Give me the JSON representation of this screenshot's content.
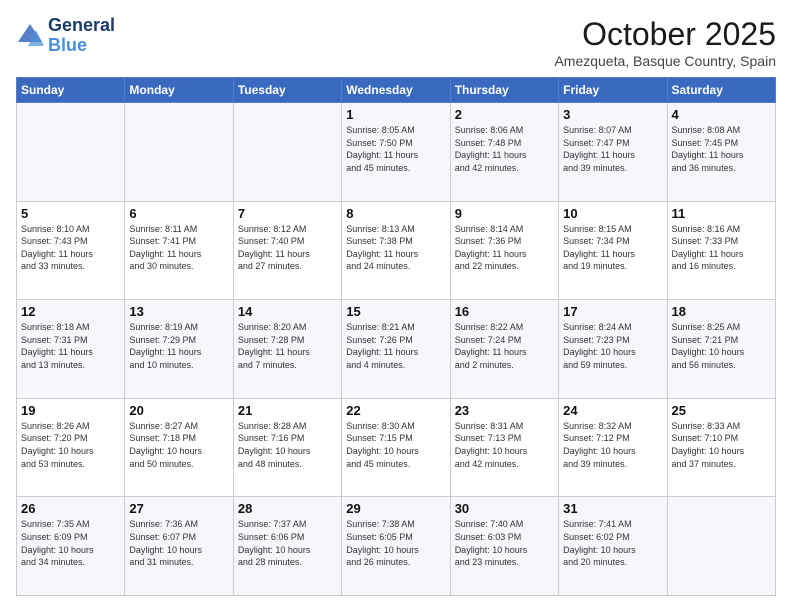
{
  "logo": {
    "line1": "General",
    "line2": "Blue"
  },
  "header": {
    "title": "October 2025",
    "subtitle": "Amezqueta, Basque Country, Spain"
  },
  "weekdays": [
    "Sunday",
    "Monday",
    "Tuesday",
    "Wednesday",
    "Thursday",
    "Friday",
    "Saturday"
  ],
  "weeks": [
    [
      {
        "day": "",
        "info": ""
      },
      {
        "day": "",
        "info": ""
      },
      {
        "day": "",
        "info": ""
      },
      {
        "day": "1",
        "info": "Sunrise: 8:05 AM\nSunset: 7:50 PM\nDaylight: 11 hours\nand 45 minutes."
      },
      {
        "day": "2",
        "info": "Sunrise: 8:06 AM\nSunset: 7:48 PM\nDaylight: 11 hours\nand 42 minutes."
      },
      {
        "day": "3",
        "info": "Sunrise: 8:07 AM\nSunset: 7:47 PM\nDaylight: 11 hours\nand 39 minutes."
      },
      {
        "day": "4",
        "info": "Sunrise: 8:08 AM\nSunset: 7:45 PM\nDaylight: 11 hours\nand 36 minutes."
      }
    ],
    [
      {
        "day": "5",
        "info": "Sunrise: 8:10 AM\nSunset: 7:43 PM\nDaylight: 11 hours\nand 33 minutes."
      },
      {
        "day": "6",
        "info": "Sunrise: 8:11 AM\nSunset: 7:41 PM\nDaylight: 11 hours\nand 30 minutes."
      },
      {
        "day": "7",
        "info": "Sunrise: 8:12 AM\nSunset: 7:40 PM\nDaylight: 11 hours\nand 27 minutes."
      },
      {
        "day": "8",
        "info": "Sunrise: 8:13 AM\nSunset: 7:38 PM\nDaylight: 11 hours\nand 24 minutes."
      },
      {
        "day": "9",
        "info": "Sunrise: 8:14 AM\nSunset: 7:36 PM\nDaylight: 11 hours\nand 22 minutes."
      },
      {
        "day": "10",
        "info": "Sunrise: 8:15 AM\nSunset: 7:34 PM\nDaylight: 11 hours\nand 19 minutes."
      },
      {
        "day": "11",
        "info": "Sunrise: 8:16 AM\nSunset: 7:33 PM\nDaylight: 11 hours\nand 16 minutes."
      }
    ],
    [
      {
        "day": "12",
        "info": "Sunrise: 8:18 AM\nSunset: 7:31 PM\nDaylight: 11 hours\nand 13 minutes."
      },
      {
        "day": "13",
        "info": "Sunrise: 8:19 AM\nSunset: 7:29 PM\nDaylight: 11 hours\nand 10 minutes."
      },
      {
        "day": "14",
        "info": "Sunrise: 8:20 AM\nSunset: 7:28 PM\nDaylight: 11 hours\nand 7 minutes."
      },
      {
        "day": "15",
        "info": "Sunrise: 8:21 AM\nSunset: 7:26 PM\nDaylight: 11 hours\nand 4 minutes."
      },
      {
        "day": "16",
        "info": "Sunrise: 8:22 AM\nSunset: 7:24 PM\nDaylight: 11 hours\nand 2 minutes."
      },
      {
        "day": "17",
        "info": "Sunrise: 8:24 AM\nSunset: 7:23 PM\nDaylight: 10 hours\nand 59 minutes."
      },
      {
        "day": "18",
        "info": "Sunrise: 8:25 AM\nSunset: 7:21 PM\nDaylight: 10 hours\nand 56 minutes."
      }
    ],
    [
      {
        "day": "19",
        "info": "Sunrise: 8:26 AM\nSunset: 7:20 PM\nDaylight: 10 hours\nand 53 minutes."
      },
      {
        "day": "20",
        "info": "Sunrise: 8:27 AM\nSunset: 7:18 PM\nDaylight: 10 hours\nand 50 minutes."
      },
      {
        "day": "21",
        "info": "Sunrise: 8:28 AM\nSunset: 7:16 PM\nDaylight: 10 hours\nand 48 minutes."
      },
      {
        "day": "22",
        "info": "Sunrise: 8:30 AM\nSunset: 7:15 PM\nDaylight: 10 hours\nand 45 minutes."
      },
      {
        "day": "23",
        "info": "Sunrise: 8:31 AM\nSunset: 7:13 PM\nDaylight: 10 hours\nand 42 minutes."
      },
      {
        "day": "24",
        "info": "Sunrise: 8:32 AM\nSunset: 7:12 PM\nDaylight: 10 hours\nand 39 minutes."
      },
      {
        "day": "25",
        "info": "Sunrise: 8:33 AM\nSunset: 7:10 PM\nDaylight: 10 hours\nand 37 minutes."
      }
    ],
    [
      {
        "day": "26",
        "info": "Sunrise: 7:35 AM\nSunset: 6:09 PM\nDaylight: 10 hours\nand 34 minutes."
      },
      {
        "day": "27",
        "info": "Sunrise: 7:36 AM\nSunset: 6:07 PM\nDaylight: 10 hours\nand 31 minutes."
      },
      {
        "day": "28",
        "info": "Sunrise: 7:37 AM\nSunset: 6:06 PM\nDaylight: 10 hours\nand 28 minutes."
      },
      {
        "day": "29",
        "info": "Sunrise: 7:38 AM\nSunset: 6:05 PM\nDaylight: 10 hours\nand 26 minutes."
      },
      {
        "day": "30",
        "info": "Sunrise: 7:40 AM\nSunset: 6:03 PM\nDaylight: 10 hours\nand 23 minutes."
      },
      {
        "day": "31",
        "info": "Sunrise: 7:41 AM\nSunset: 6:02 PM\nDaylight: 10 hours\nand 20 minutes."
      },
      {
        "day": "",
        "info": ""
      }
    ]
  ]
}
